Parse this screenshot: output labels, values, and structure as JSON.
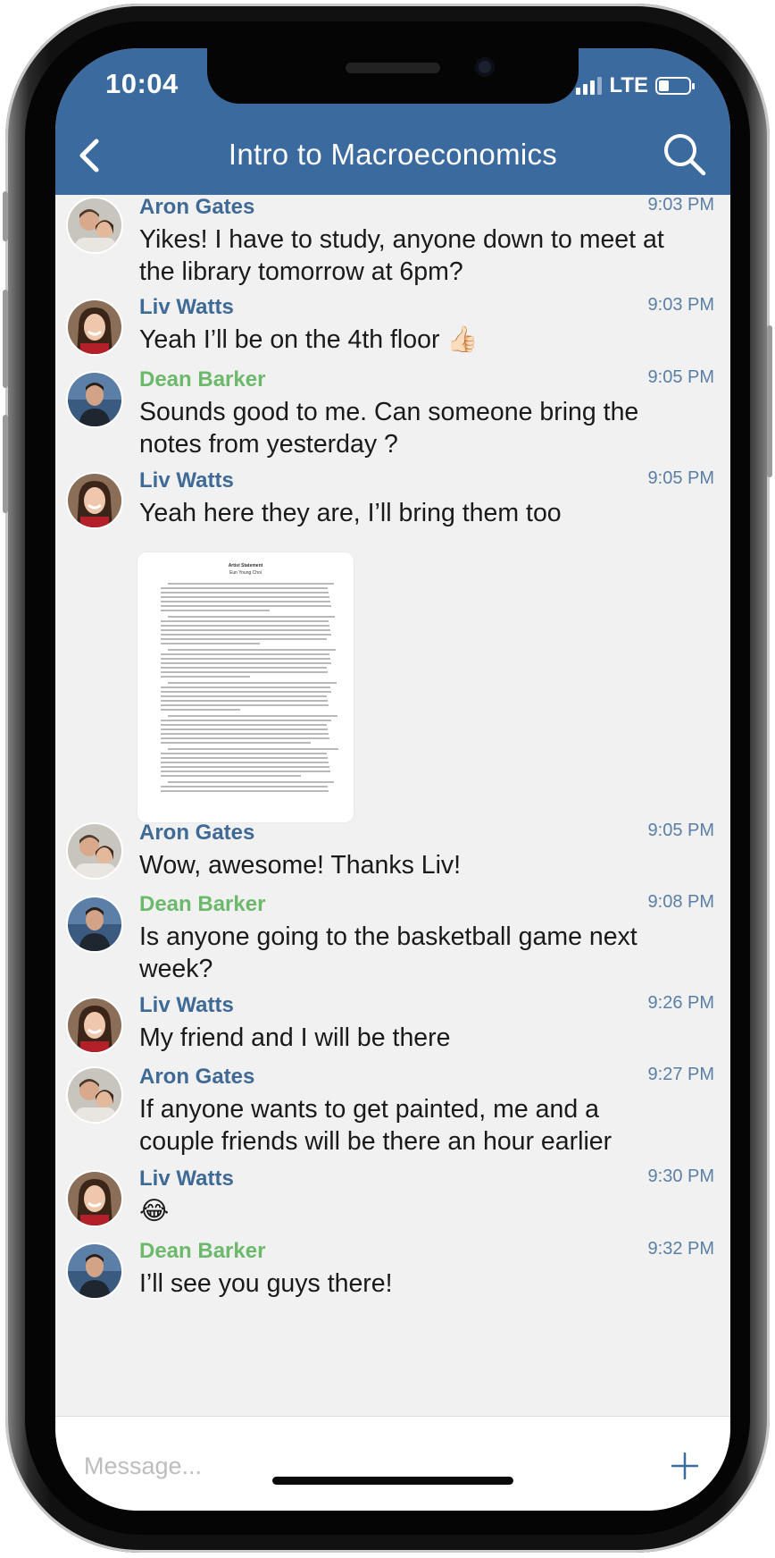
{
  "status_bar": {
    "time": "10:04",
    "network": "LTE",
    "signal_bars_active": 3,
    "signal_bars_total": 4,
    "battery_level": 0.35
  },
  "header": {
    "title": "Intro to Macroeconomics",
    "back_icon": "chevron-left-icon",
    "search_icon": "search-icon",
    "background_color": "#3b6a9e"
  },
  "colors": {
    "blue_sender": "#3f6a96",
    "green_sender": "#6cb96c"
  },
  "messages": [
    {
      "sender": "Aron Gates",
      "time": "9:03 PM",
      "text": "Yikes! I have to study, anyone down to meet at the library tomorrow at 6pm?"
    },
    {
      "sender": "Liv Watts",
      "time": "9:03 PM",
      "text": "Yeah I’ll be on the 4th floor 👍🏻"
    },
    {
      "sender": "Dean Barker",
      "time": "9:05 PM",
      "text": "Sounds good to me. Can someone bring the notes from yesterday ?"
    },
    {
      "sender": "Liv Watts",
      "time": "9:05 PM",
      "text": "Yeah here they are, I’ll bring them too"
    },
    {
      "sender": "Aron Gates",
      "time": "9:05 PM",
      "text": "Wow, awesome! Thanks Liv!"
    },
    {
      "sender": "Dean Barker",
      "time": "9:08 PM",
      "text": "Is anyone going to the basketball game next week?"
    },
    {
      "sender": "Liv Watts",
      "time": "9:26 PM",
      "text": "My friend and I will be there"
    },
    {
      "sender": "Aron Gates",
      "time": "9:27 PM",
      "text": "If anyone wants to get painted, me and a couple friends will be there an hour earlier"
    },
    {
      "sender": "Liv Watts",
      "time": "9:30 PM",
      "text": "😂"
    },
    {
      "sender": "Dean Barker",
      "time": "9:32 PM",
      "text": "I’ll see you guys there!"
    }
  ],
  "attachment": {
    "title_line_1": "Artist Statement",
    "title_line_2": "Eun Young Choi"
  },
  "composer": {
    "placeholder": "Message...",
    "add_icon": "plus-icon"
  }
}
